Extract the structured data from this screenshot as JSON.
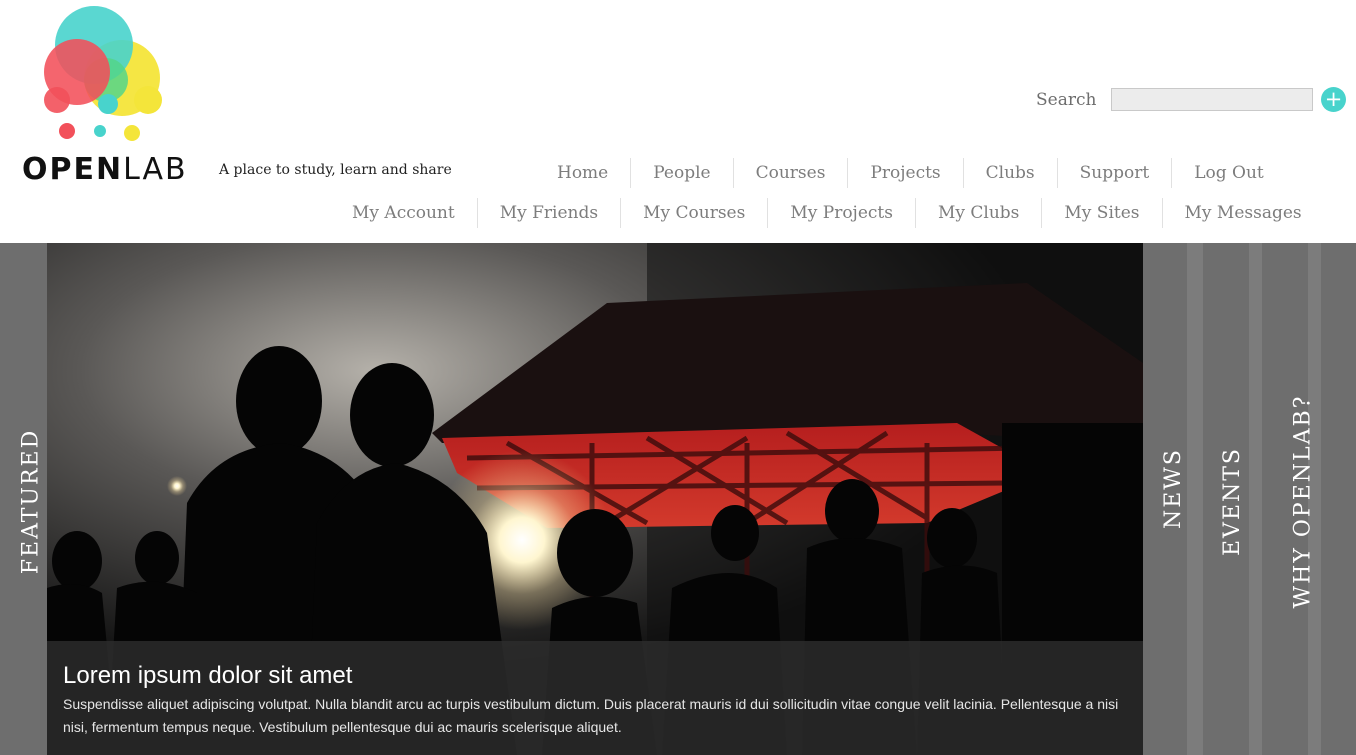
{
  "brand": {
    "wordmark_bold": "OPEN",
    "wordmark_light": "LAB",
    "tagline": "A place to study, learn and share",
    "colors": {
      "teal": "#48d3cc",
      "coral": "#f2505a",
      "yellow": "#f4e53a",
      "green": "#54d58a"
    }
  },
  "search": {
    "label": "Search",
    "placeholder": "",
    "value": "",
    "button_icon": "plus-circle-icon",
    "button_glyph": "+"
  },
  "nav_main": [
    {
      "label": "Home"
    },
    {
      "label": "People"
    },
    {
      "label": "Courses"
    },
    {
      "label": "Projects"
    },
    {
      "label": "Clubs"
    },
    {
      "label": "Support"
    },
    {
      "label": "Log Out"
    }
  ],
  "nav_sub": [
    {
      "label": "My Account"
    },
    {
      "label": "My Friends"
    },
    {
      "label": "My Courses"
    },
    {
      "label": "My Projects"
    },
    {
      "label": "My Clubs"
    },
    {
      "label": "My Sites"
    },
    {
      "label": "My Messages"
    }
  ],
  "hero": {
    "featured_tab": "FEATURED",
    "right_tabs": [
      {
        "label": "NEWS"
      },
      {
        "label": "EVENTS"
      },
      {
        "label": "WHY OPENLAB?"
      }
    ],
    "caption": {
      "title": "Lorem ipsum dolor sit amet",
      "text": "Suspendisse aliquet adipiscing volutpat. Nulla blandit arcu ac turpis vestibulum dictum. Duis placerat mauris id dui sollicitudin vitae congue velit lacinia. Pellentesque a nisi nisi, fermentum tempus neque. Vestibulum pellentesque dui ac mauris scelerisque aliquet."
    }
  }
}
